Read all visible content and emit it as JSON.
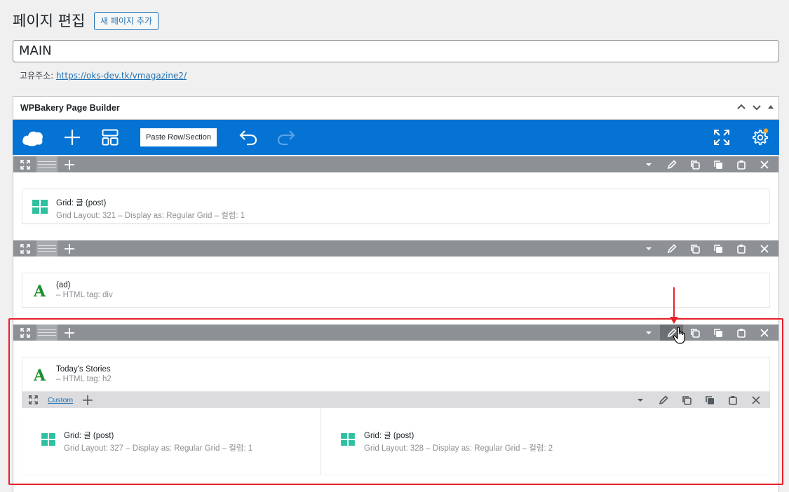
{
  "page": {
    "title": "페이지 편집",
    "add_new_label": "새 페이지 추가",
    "post_title": "MAIN",
    "permalink_label": "고유주소:",
    "permalink_url": "https://oks-dev.tk/vmagazine2/"
  },
  "builder": {
    "panel_title": "WPBakery Page Builder",
    "paste_label": "Paste Row/Section"
  },
  "rows": [
    {
      "element": {
        "icon": "grid-icon",
        "title": "Grid: 글 (post)",
        "subtitle": "Grid Layout: 321 – Display as: Regular Grid – 컬럼: 1"
      }
    },
    {
      "element": {
        "icon": "text-a-icon",
        "title": "(ad)",
        "subtitle": "– HTML tag: div"
      }
    },
    {
      "element": {
        "icon": "text-a-icon",
        "title": "Today's Stories",
        "subtitle": "– HTML tag: h2"
      },
      "inner_row": {
        "label": "Custom",
        "columns": [
          {
            "icon": "grid-icon",
            "title": "Grid: 글 (post)",
            "subtitle": "Grid Layout: 327 – Display as: Regular Grid – 컬럼: 1"
          },
          {
            "icon": "grid-icon",
            "title": "Grid: 글 (post)",
            "subtitle": "Grid Layout: 328 – Display as: Regular Grid – 컬럼: 2"
          }
        ]
      }
    }
  ],
  "colors": {
    "navbar": "#0473d3",
    "row_bar": "#8d9196",
    "accent_link": "#2271b1",
    "grid_icon": "#2fc0a0",
    "text_icon": "#1a8f2e",
    "highlight": "#e8202a"
  }
}
